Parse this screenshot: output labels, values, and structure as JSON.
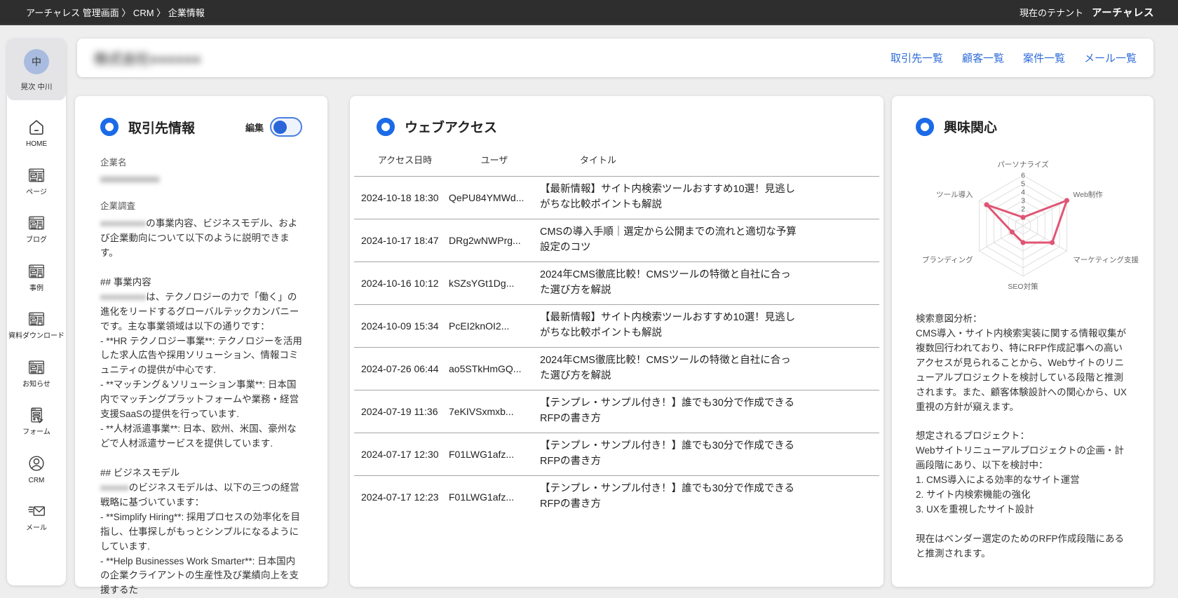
{
  "topbar": {
    "breadcrumb": "アーチャレス 管理画面 〉 CRM 〉 企業情報",
    "tenant_label": "現在のテナント",
    "tenant_name": "アーチャレス"
  },
  "sidebar": {
    "user": {
      "avatar_initial": "中",
      "name": "晃次 中川"
    },
    "items": [
      {
        "id": "home",
        "icon": "home",
        "label": "HOME"
      },
      {
        "id": "page",
        "icon": "page",
        "label": "ページ"
      },
      {
        "id": "blog",
        "icon": "page",
        "label": "ブログ"
      },
      {
        "id": "case",
        "icon": "page",
        "label": "事例"
      },
      {
        "id": "download",
        "icon": "page",
        "label": "資料ダウンロード"
      },
      {
        "id": "news",
        "icon": "page",
        "label": "お知らせ"
      },
      {
        "id": "form",
        "icon": "form",
        "label": "フォーム"
      },
      {
        "id": "crm",
        "icon": "person",
        "label": "CRM"
      },
      {
        "id": "mail",
        "icon": "mail",
        "label": "メール"
      }
    ]
  },
  "header": {
    "company_name_redacted": "株式会社●●●●●●",
    "links": [
      {
        "id": "partner-list",
        "label": "取引先一覧"
      },
      {
        "id": "customer-list",
        "label": "顧客一覧"
      },
      {
        "id": "case-list",
        "label": "案件一覧"
      },
      {
        "id": "mail-list",
        "label": "メール一覧"
      }
    ]
  },
  "account": {
    "title": "取引先情報",
    "edit_label": "編集",
    "edit_toggle_on": true,
    "company_name_label": "企業名",
    "company_name_redacted": "●●●●●●●●●●",
    "research_label": "企業調査",
    "research_lines": [
      [
        {
          "r": true,
          "t": "●●●●●●●●"
        },
        {
          "r": false,
          "t": "の事業内容、ビジネスモデル、および企業動向について以下のように説明できます。"
        }
      ],
      [],
      [
        {
          "r": false,
          "t": "## 事業内容"
        }
      ],
      [
        {
          "r": true,
          "t": "●●●●●●●●"
        },
        {
          "r": false,
          "t": "は、テクノロジーの力で「働く」の進化をリードするグローバルテックカンパニーです。主な事業領域は以下の通りです："
        }
      ],
      [
        {
          "r": false,
          "t": "- **HR テクノロジー事業**: テクノロジーを活用した求人広告や採用ソリューション、情報コミュニティの提供が中心です."
        }
      ],
      [
        {
          "r": false,
          "t": "- **マッチング＆ソリューション事業**: 日本国内でマッチングプラットフォームや業務・経営支援SaaSの提供を行っています."
        }
      ],
      [
        {
          "r": false,
          "t": "- **人材派遣事業**: 日本、欧州、米国、豪州などで人材派遣サービスを提供しています."
        }
      ],
      [],
      [
        {
          "r": false,
          "t": "## ビジネスモデル"
        }
      ],
      [
        {
          "r": true,
          "t": "●●●●●"
        },
        {
          "r": false,
          "t": "のビジネスモデルは、以下の三つの経営戦略に基づいています："
        }
      ],
      [
        {
          "r": false,
          "t": "- **Simplify Hiring**: 採用プロセスの効率化を目指し、仕事探しがもっとシンプルになるようにしています."
        }
      ],
      [
        {
          "r": false,
          "t": "- **Help Businesses Work Smarter**: 日本国内の企業クライアントの生産性及び業績向上を支援するた"
        }
      ]
    ]
  },
  "web_access": {
    "title": "ウェブアクセス",
    "columns": [
      "アクセス日時",
      "ユーザ",
      "タイトル"
    ],
    "rows": [
      {
        "datetime": "2024-10-18 18:30",
        "user": "QePU84YMWd...",
        "title": "【最新情報】サイト内検索ツールおすすめ10選！見逃しがちな比較ポイントも解説"
      },
      {
        "datetime": "2024-10-17 18:47",
        "user": "DRg2wNWPrg...",
        "title": "CMSの導入手順｜選定から公開までの流れと適切な予算設定のコツ"
      },
      {
        "datetime": "2024-10-16 10:12",
        "user": "kSZsYGt1Dg...",
        "title": "2024年CMS徹底比較！CMSツールの特徴と自社に合った選び方を解説"
      },
      {
        "datetime": "2024-10-09 15:34",
        "user": "PcEI2knOI2...",
        "title": "【最新情報】サイト内検索ツールおすすめ10選！見逃しがちな比較ポイントも解説"
      },
      {
        "datetime": "2024-07-26 06:44",
        "user": "ao5STkHmGQ...",
        "title": "2024年CMS徹底比較！CMSツールの特徴と自社に合った選び方を解説"
      },
      {
        "datetime": "2024-07-19 11:36",
        "user": "7eKIVSxmxb...",
        "title": "【テンプレ・サンプル付き！】誰でも30分で作成できるRFPの書き方"
      },
      {
        "datetime": "2024-07-17 12:30",
        "user": "F01LWG1afz...",
        "title": "【テンプレ・サンプル付き！】誰でも30分で作成できるRFPの書き方"
      },
      {
        "datetime": "2024-07-17 12:23",
        "user": "F01LWG1afz...",
        "title": "【テンプレ・サンプル付き！】誰でも30分で作成できるRFPの書き方"
      }
    ]
  },
  "interest": {
    "title": "興味関心",
    "analysis_text": "検索意図分析：\nCMS導入・サイト内検索実装に関する情報収集が複数回行われており、特にRFP作成記事への高いアクセスが見られることから、Webサイトのリニューアルプロジェクトを検討している段階と推測されます。また、顧客体験設計への関心から、UX重視の方針が窺えます。\n\n想定されるプロジェクト：\nWebサイトリニューアルプロジェクトの企画・計画段階にあり、以下を検討中：\n1. CMS導入による効率的なサイト運営\n2. サイト内検索機能の強化\n3. UXを重視したサイト設計\n\n現在はベンダー選定のためのRFP作成段階にあると推測されます。"
  },
  "chart_data": {
    "type": "radar",
    "title": "興味関心",
    "categories": [
      "パーソナライズ",
      "Web制作",
      "マーケティング支援",
      "SEO対策",
      "ブランディング",
      "ツール導入"
    ],
    "values": [
      1,
      6,
      4,
      2,
      1.5,
      5
    ],
    "ticks": [
      1,
      2,
      3,
      4,
      5,
      6
    ],
    "rmin": 0,
    "rmax": 6,
    "grid": true,
    "line_color": "#e05574",
    "grid_color": "#d9d9d9"
  },
  "colors": {
    "accent_blue": "#1b6ae8",
    "link_blue": "#2e6bd9",
    "radar_pink": "#e05574",
    "topbar_bg": "#2e2e2e",
    "page_bg": "#eeeeef"
  }
}
